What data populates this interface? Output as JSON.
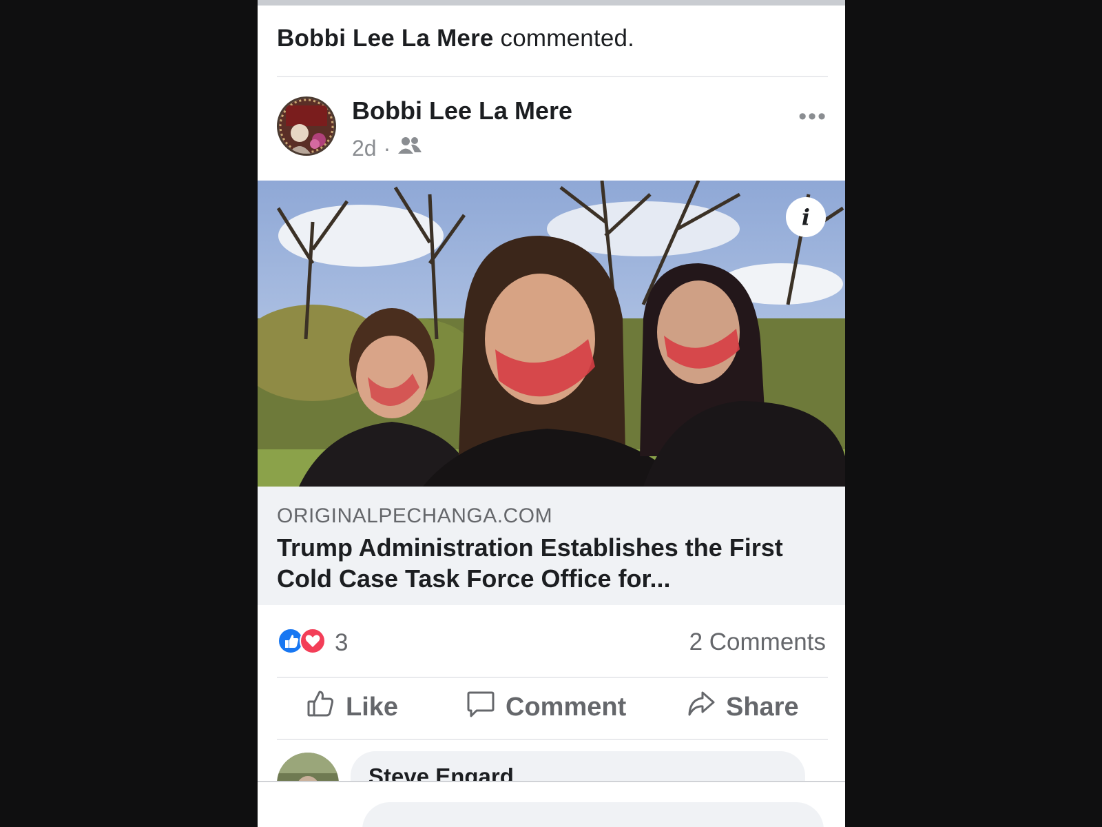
{
  "notification": {
    "actor": "Bobbi Lee La Mere",
    "action": "commented."
  },
  "post": {
    "author": "Bobbi Lee La Mere",
    "time": "2d",
    "separator": "·",
    "audience_icon": "friends-icon",
    "more_icon": "more-options-icon",
    "more_glyph": "•••",
    "info_glyph": "i"
  },
  "link": {
    "domain": "ORIGINALPECHANGA.COM",
    "title": "Trump Administration Establishes the First Cold Case Task Force Office for..."
  },
  "stats": {
    "reaction_count": "3",
    "comments": "2 Comments"
  },
  "actions": {
    "like": "Like",
    "comment": "Comment",
    "share": "Share"
  },
  "comment_preview": {
    "author": "Steve Engard"
  },
  "colors": {
    "like_blue": "#1877f2",
    "love_red": "#f33e58",
    "text_gray": "#65676b",
    "link_bg": "#f0f2f5"
  }
}
